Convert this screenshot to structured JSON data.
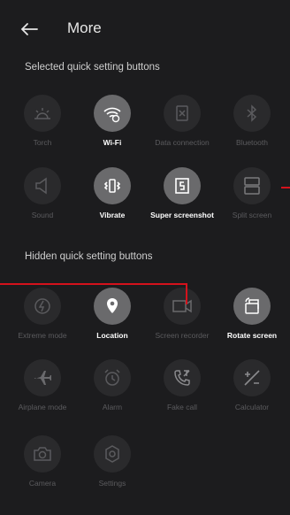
{
  "header": {
    "title": "More"
  },
  "sections": {
    "selected": "Selected quick setting buttons",
    "hidden": "Hidden quick setting buttons"
  },
  "selected_tiles": [
    {
      "label": "Torch",
      "icon": "torch-icon",
      "active": false
    },
    {
      "label": "Wi-Fi",
      "icon": "wifi-icon",
      "active": true
    },
    {
      "label": "Data connection",
      "icon": "data-icon",
      "active": false
    },
    {
      "label": "Bluetooth",
      "icon": "bluetooth-icon",
      "active": false
    },
    {
      "label": "Sound",
      "icon": "sound-icon",
      "active": false
    },
    {
      "label": "Vibrate",
      "icon": "vibrate-icon",
      "active": true
    },
    {
      "label": "Super screenshot",
      "icon": "screenshot-icon",
      "active": true
    },
    {
      "label": "Split screen",
      "icon": "split-screen-icon",
      "active": false
    }
  ],
  "hidden_tiles": [
    {
      "label": "Extreme mode",
      "icon": "extreme-icon",
      "active": false
    },
    {
      "label": "Location",
      "icon": "location-icon",
      "active": true
    },
    {
      "label": "Screen recorder",
      "icon": "screen-recorder-icon",
      "active": false
    },
    {
      "label": "Rotate screen",
      "icon": "rotate-icon",
      "active": true
    },
    {
      "label": "Airplane mode",
      "icon": "airplane-icon",
      "active": false
    },
    {
      "label": "Alarm",
      "icon": "alarm-icon",
      "active": false
    },
    {
      "label": "Fake call",
      "icon": "fake-call-icon",
      "active": false
    },
    {
      "label": "Calculator",
      "icon": "calculator-icon",
      "active": false
    },
    {
      "label": "Camera",
      "icon": "camera-icon",
      "active": false
    },
    {
      "label": "Settings",
      "icon": "settings-icon",
      "active": false
    }
  ],
  "colors": {
    "annotation": "#d4121c",
    "background": "#1c1c1e"
  }
}
